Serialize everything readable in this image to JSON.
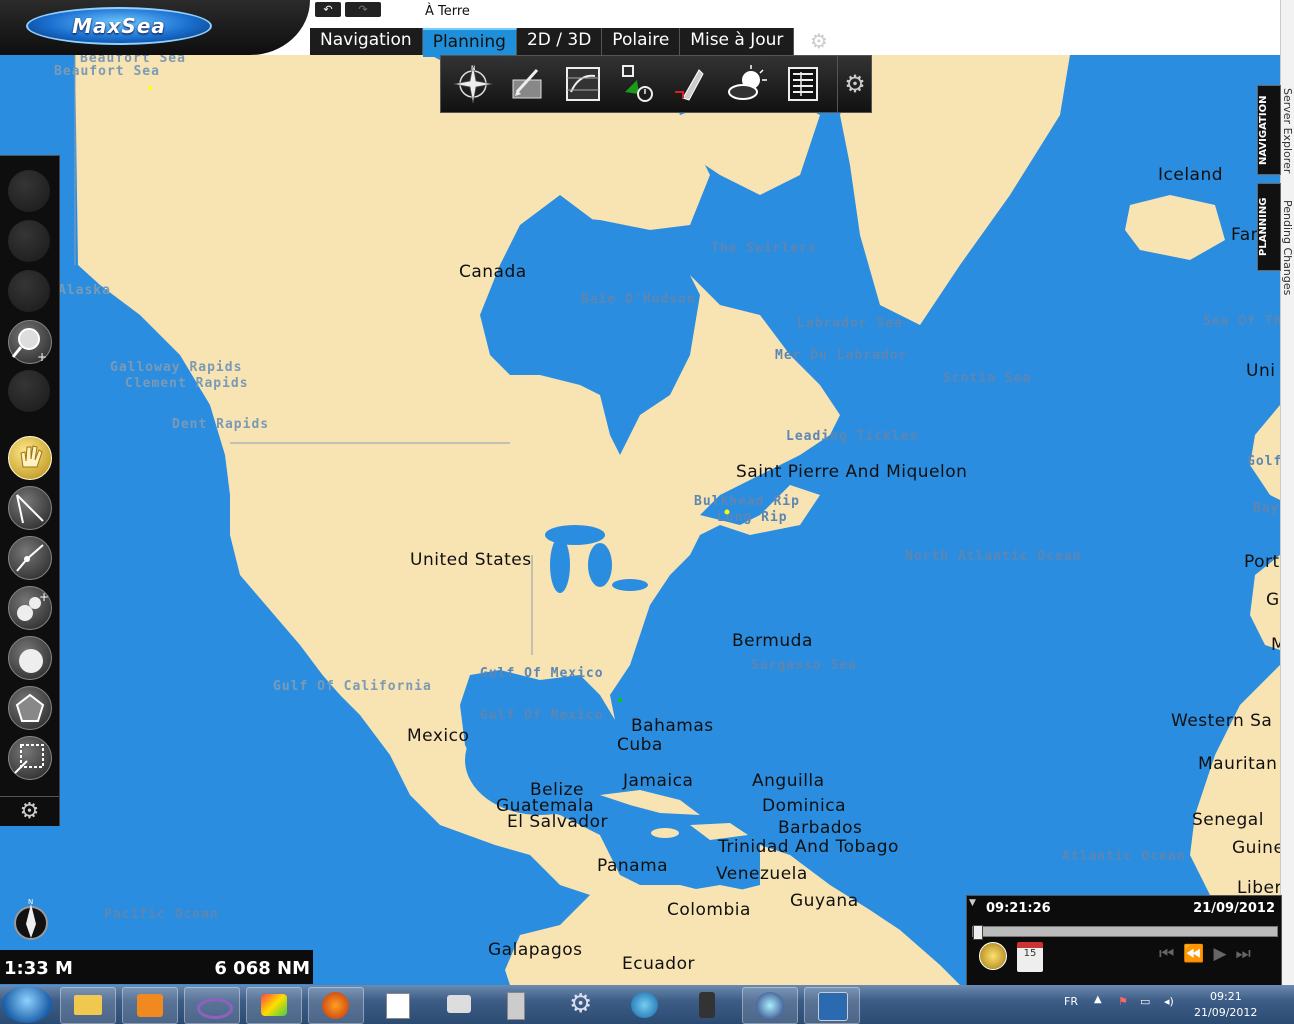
{
  "app": {
    "logo": "MaxSea",
    "status": "À Terre",
    "undo_label": "↶",
    "redo_label": "↷"
  },
  "tabs": [
    {
      "label": "Navigation",
      "active": false
    },
    {
      "label": "Planning",
      "active": true
    },
    {
      "label": "2D / 3D",
      "active": false
    },
    {
      "label": "Polaire",
      "active": false
    },
    {
      "label": "Mise à Jour",
      "active": false
    }
  ],
  "planning_toolbar": [
    "compass-rose-icon",
    "route-editor-icon",
    "chart-overlay-icon",
    "route-timer-icon",
    "boat-route-icon",
    "weather-icon",
    "report-icon",
    "settings-gear-icon"
  ],
  "side_tabs": {
    "navigation": "NAVIGATION",
    "planning": "PLANNING",
    "server_explorer": "Server Explorer",
    "pending_changes": "Pending Changes"
  },
  "map": {
    "countries": [
      {
        "name": "Canada"
      },
      {
        "name": "United States"
      },
      {
        "name": "Mexico"
      },
      {
        "name": "Iceland"
      },
      {
        "name": "Saint Pierre And Miquelon"
      },
      {
        "name": "Bermuda"
      },
      {
        "name": "Bahamas"
      },
      {
        "name": "Cuba"
      },
      {
        "name": "Jamaica"
      },
      {
        "name": "Anguilla"
      },
      {
        "name": "Dominica"
      },
      {
        "name": "Barbados"
      },
      {
        "name": "Trinidad And Tobago"
      },
      {
        "name": "Belize"
      },
      {
        "name": "Guatemala"
      },
      {
        "name": "El Salvador"
      },
      {
        "name": "Panama"
      },
      {
        "name": "Venezuela"
      },
      {
        "name": "Guyana"
      },
      {
        "name": "Colombia"
      },
      {
        "name": "Galapagos"
      },
      {
        "name": "Ecuador"
      },
      {
        "name": "Western Sa"
      },
      {
        "name": "Mauritan"
      },
      {
        "name": "Senegal"
      },
      {
        "name": "Guine"
      },
      {
        "name": "Liber"
      },
      {
        "name": "Far"
      },
      {
        "name": "Uni"
      },
      {
        "name": "Port"
      },
      {
        "name": "G"
      },
      {
        "name": "M"
      }
    ],
    "seas": [
      {
        "name": "Beaufort Sea"
      },
      {
        "name": "Beaufort Sea"
      },
      {
        "name": "Alaska"
      },
      {
        "name": "The Swirlers"
      },
      {
        "name": "Baie D'Hudson"
      },
      {
        "name": "Labrador Sea"
      },
      {
        "name": "Mer Du Labrador"
      },
      {
        "name": "Scotia Sea"
      },
      {
        "name": "Sea Of Th"
      },
      {
        "name": "Galloway Rapids"
      },
      {
        "name": "Clement Rapids"
      },
      {
        "name": "Dent Rapids"
      },
      {
        "name": "Leading Tickles"
      },
      {
        "name": "Bulkhead Rip"
      },
      {
        "name": "Long Rip"
      },
      {
        "name": "North Atlantic Ocean"
      },
      {
        "name": "Sargasso Sea"
      },
      {
        "name": "Gulf Of Mexico"
      },
      {
        "name": "Gulf Of Mexico"
      },
      {
        "name": "Gulf Of California"
      },
      {
        "name": "Atlantic Ocean"
      },
      {
        "name": "Pacific Ocean"
      },
      {
        "name": "Golf"
      },
      {
        "name": "Bay"
      }
    ]
  },
  "scale": {
    "left": "1:33 M",
    "right": "6 068 NM"
  },
  "time_panel": {
    "time": "09:21:26",
    "date": "21/09/2012",
    "slider_position": 0.0
  },
  "taskbar": {
    "language": "FR",
    "clock_time": "09:21",
    "clock_date": "21/09/2012",
    "apps": [
      "explorer-icon",
      "outlook-icon",
      "visual-studio-icon",
      "paint-icon",
      "firefox-icon",
      "notepad-icon",
      "network-icon",
      "server-icon",
      "settings-icon",
      "ie-icon",
      "keyboard-icon",
      "maxsea-icon",
      "maxsea-mx-icon"
    ]
  },
  "colors": {
    "sea": "#2a8de0",
    "land": "#f8e3b3",
    "tab_active": "#1e8fd8",
    "toolbar": "#111111"
  }
}
